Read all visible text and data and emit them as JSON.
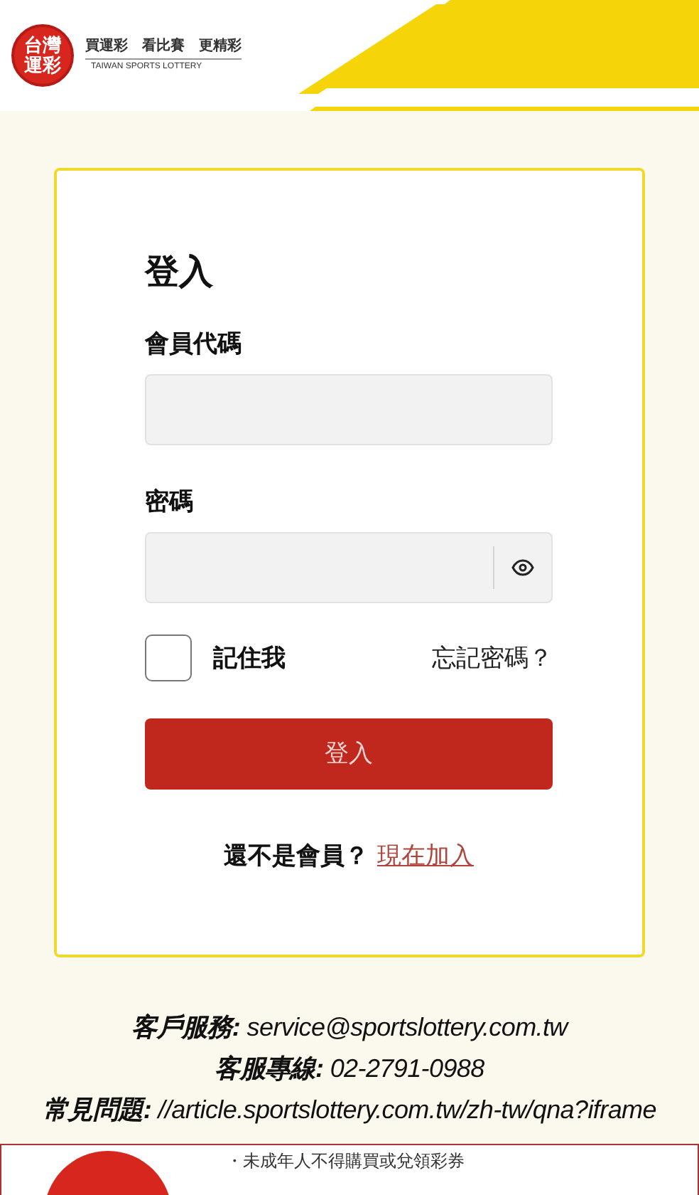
{
  "header": {
    "logo_top": "台灣",
    "logo_bottom": "運彩",
    "slogan": "買運彩　看比賽　更精彩",
    "brand_en": "TAIWAN SPORTS LOTTERY"
  },
  "login": {
    "title": "登入",
    "fields": [
      {
        "label": "會員代碼",
        "kind": "text"
      },
      {
        "label": "密碼",
        "kind": "password"
      }
    ],
    "remember": {
      "label": "記住我",
      "checked": false
    },
    "forgot": "忘記密碼？",
    "submit": "登入",
    "signup_prompt": "還不是會員？",
    "signup_link": "現在加入"
  },
  "contacts": [
    {
      "label": "客戶服務:",
      "value": "service@sportslottery.com.tw"
    },
    {
      "label": "客服專線:",
      "value": "02-2791-0988"
    },
    {
      "label": "常見問題:",
      "value": "//article.sportslottery.com.tw/zh-tw/qna?iframe"
    }
  ],
  "notice": "・未成年人不得購買或兌領彩券"
}
